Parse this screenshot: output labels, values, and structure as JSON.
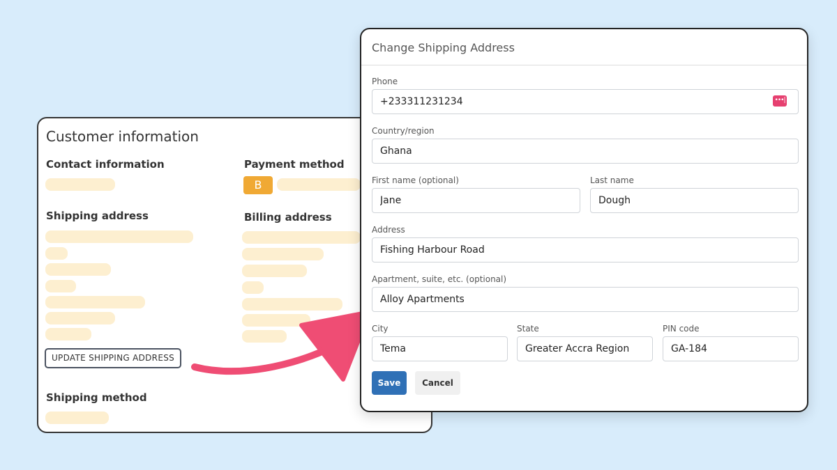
{
  "customer_card": {
    "title": "Customer information",
    "contact_heading": "Contact information",
    "payment_heading": "Payment method",
    "payment_badge": "B",
    "shipping_heading": "Shipping address",
    "billing_heading": "Billing address",
    "update_button": "UPDATE SHIPPING ADDRESS",
    "shipping_method_heading": "Shipping method"
  },
  "modal": {
    "title": "Change Shipping Address",
    "phone_label": "Phone",
    "phone_value": "+233311231234",
    "country_label": "Country/region",
    "country_value": "Ghana",
    "first_name_label": "First name (optional)",
    "first_name_value": "Jane",
    "last_name_label": "Last name",
    "last_name_value": "Dough",
    "address_label": "Address",
    "address_value": "Fishing Harbour Road",
    "apartment_label": "Apartment, suite, etc. (optional)",
    "apartment_value": "Alloy Apartments",
    "city_label": "City",
    "city_value": "Tema",
    "state_label": "State",
    "state_value": "Greater Accra Region",
    "pin_label": "PIN code",
    "pin_value": "GA-184",
    "save_button": "Save",
    "cancel_button": "Cancel"
  },
  "colors": {
    "background": "#d8ecfb",
    "placeholder": "#fdefd0",
    "payment_badge": "#f0a934",
    "arrow": "#ef4d74",
    "save_button": "#2f70b6"
  },
  "icons": {
    "password_manager": "password-manager-icon"
  }
}
